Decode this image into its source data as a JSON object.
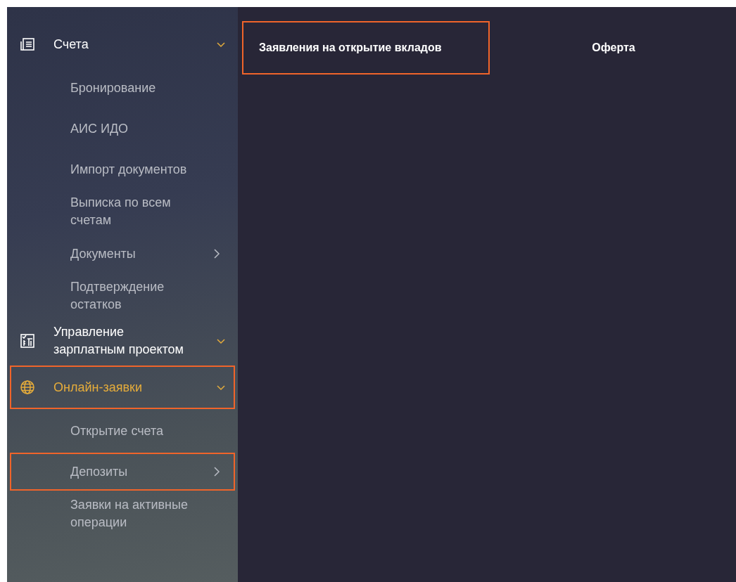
{
  "sidebar": {
    "sections": [
      {
        "kind": "accounts",
        "label": "Счета",
        "expanded": true,
        "highlighted": false,
        "children": [
          {
            "label": "Бронирование",
            "has_submenu": false,
            "highlighted": false
          },
          {
            "label": "АИС ИДО",
            "has_submenu": false,
            "highlighted": false
          },
          {
            "label": "Импорт документов",
            "has_submenu": false,
            "highlighted": false
          },
          {
            "label": "Выписка по всем счетам",
            "has_submenu": false,
            "highlighted": false
          },
          {
            "label": "Документы",
            "has_submenu": true,
            "highlighted": false
          },
          {
            "label": "Подтверждение остатков",
            "has_submenu": false,
            "highlighted": false
          }
        ]
      },
      {
        "kind": "salary",
        "label": "Управление зарплатным проектом",
        "expanded": true,
        "highlighted": false
      },
      {
        "kind": "online",
        "label": "Онлайн-заявки",
        "expanded": true,
        "highlighted": true,
        "children": [
          {
            "label": "Открытие счета",
            "has_submenu": false,
            "highlighted": false
          },
          {
            "label": "Депозиты",
            "has_submenu": true,
            "highlighted": true
          },
          {
            "label": "Заявки на активные операции",
            "has_submenu": false,
            "highlighted": false
          }
        ]
      }
    ]
  },
  "submenu": {
    "items": [
      {
        "label": "Заявления на открытие вкладов",
        "highlighted": true
      },
      {
        "label": "Оферта",
        "highlighted": false
      }
    ]
  }
}
